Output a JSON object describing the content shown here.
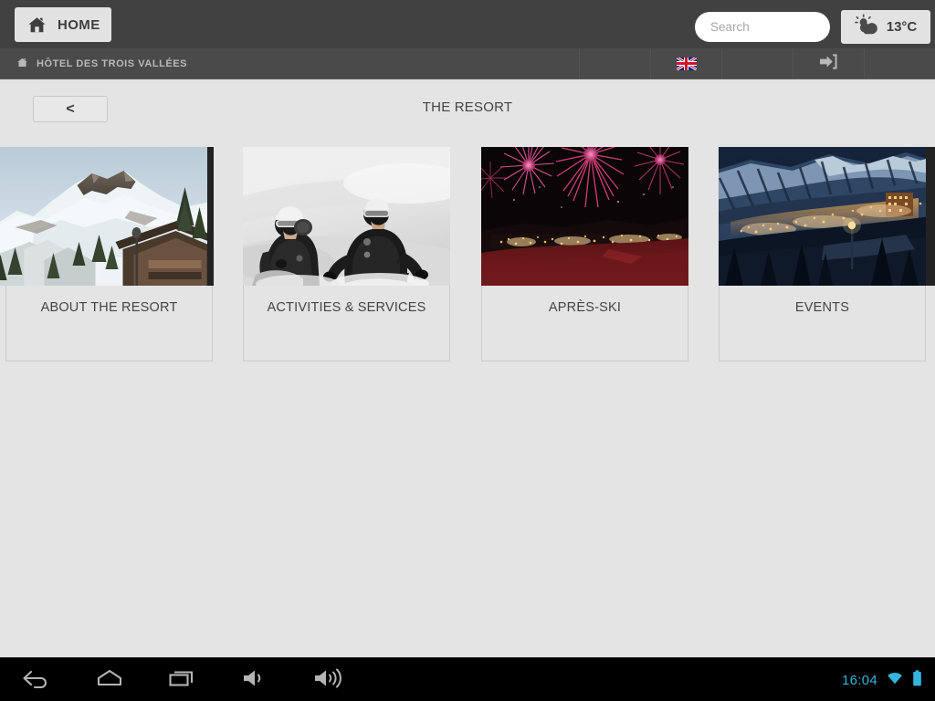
{
  "header": {
    "home_button_label": "HOME",
    "home_icon": "house-icon",
    "search": {
      "placeholder": "Search",
      "value": "",
      "icon": "search-icon"
    },
    "weather": {
      "temperature": "13°C",
      "icon": "sun-behind-cloud-icon"
    }
  },
  "breadcrumb": {
    "icon": "house-icon",
    "label": "HÔTEL DES TROIS VALLÉES"
  },
  "subheader_actions": [
    {
      "name": "language-flag",
      "icon": "uk-flag-icon",
      "label": ""
    },
    {
      "name": "login",
      "icon": "login-arrow-icon",
      "label": ""
    }
  ],
  "content": {
    "back_button_label": "<",
    "page_title": "THE RESORT"
  },
  "cards": [
    {
      "title": "ABOUT THE RESORT",
      "image_alt": "snowy-mountain-peak-with-alpine-chalets"
    },
    {
      "title": "ACTIVITIES & SERVICES",
      "image_alt": "black-and-white-photo-two-people-in-powder-snow"
    },
    {
      "title": "APRÈS-SKI",
      "image_alt": "pink-fireworks-over-lit-night-village"
    },
    {
      "title": "EVENTS",
      "image_alt": "alpine-village-lights-at-dusk-below-snowy-ridge"
    }
  ],
  "navbar": {
    "buttons": [
      {
        "name": "back",
        "icon": "back-arrow-icon"
      },
      {
        "name": "home",
        "icon": "home-outline-icon"
      },
      {
        "name": "recents",
        "icon": "recent-apps-icon"
      },
      {
        "name": "volume-down",
        "icon": "volume-down-icon"
      },
      {
        "name": "volume-up",
        "icon": "volume-up-icon"
      }
    ],
    "status": {
      "clock": "16:04",
      "wifi_icon": "wifi-icon",
      "battery_icon": "battery-full-icon"
    }
  },
  "colors": {
    "header_bg": "#414141",
    "subheader_bg": "#4a4a4a",
    "content_bg": "#e4e4e4",
    "card_border": "#cbcbcb",
    "status_accent": "#35b4dd",
    "button_face": "#e2e2e2"
  }
}
